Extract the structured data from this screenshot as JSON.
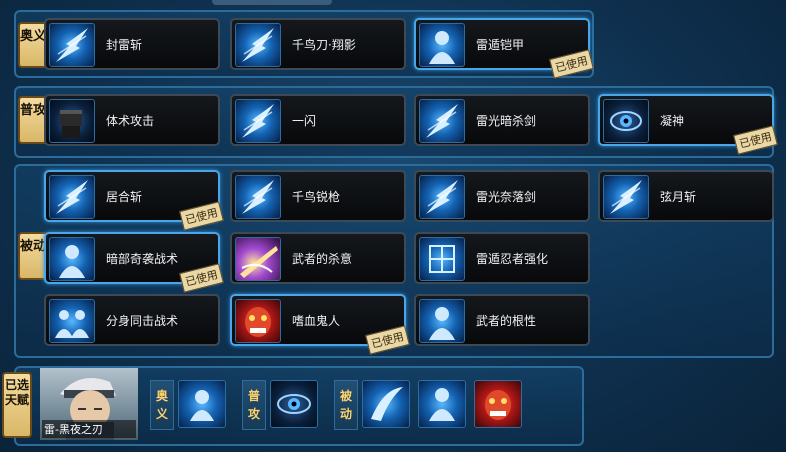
{
  "sections": [
    {
      "tag": "奥义",
      "skills": [
        {
          "name": "封雷斩",
          "icon": "lightning-blade-icon",
          "used": false
        },
        {
          "name": "千鸟刀·翔影",
          "icon": "chidori-blade-icon",
          "used": false
        },
        {
          "name": "雷遁铠甲",
          "icon": "lightning-armor-icon",
          "used": true
        }
      ]
    },
    {
      "tag": "普攻",
      "skills": [
        {
          "name": "体术攻击",
          "icon": "fist-icon",
          "used": false
        },
        {
          "name": "一闪",
          "icon": "flash-slash-icon",
          "used": false
        },
        {
          "name": "雷光暗杀剑",
          "icon": "lightning-sword-icon",
          "used": false
        },
        {
          "name": "凝神",
          "icon": "eye-icon",
          "used": true
        }
      ]
    },
    {
      "tag": "被动",
      "rows": [
        [
          {
            "name": "居合斩",
            "icon": "iai-slash-icon",
            "used": true
          },
          {
            "name": "千鸟锐枪",
            "icon": "chidori-spear-icon",
            "used": false
          },
          {
            "name": "雷光奈落剑",
            "icon": "falling-sword-icon",
            "used": false
          },
          {
            "name": "弦月斩",
            "icon": "crescent-slash-icon",
            "used": false
          }
        ],
        [
          {
            "name": "暗部奇袭战术",
            "icon": "anbu-figure-icon",
            "used": true
          },
          {
            "name": "武者的杀意",
            "icon": "killing-intent-icon",
            "used": false
          },
          {
            "name": "雷遁忍者强化",
            "icon": "thunder-glyph-icon",
            "used": false
          }
        ],
        [
          {
            "name": "分身同击战术",
            "icon": "clone-figures-icon",
            "used": false
          },
          {
            "name": "嗜血鬼人",
            "icon": "demon-face-icon",
            "used": true
          },
          {
            "name": "武者的根性",
            "icon": "warrior-face-icon",
            "used": false
          }
        ]
      ]
    }
  ],
  "used_badge": "已使用",
  "selected": {
    "tag": "已选天赋",
    "character_name": "雷-黑夜之刃",
    "groups": [
      {
        "tag": "奥义"
      },
      {
        "tag": "普攻"
      },
      {
        "tag": "被动"
      }
    ]
  }
}
